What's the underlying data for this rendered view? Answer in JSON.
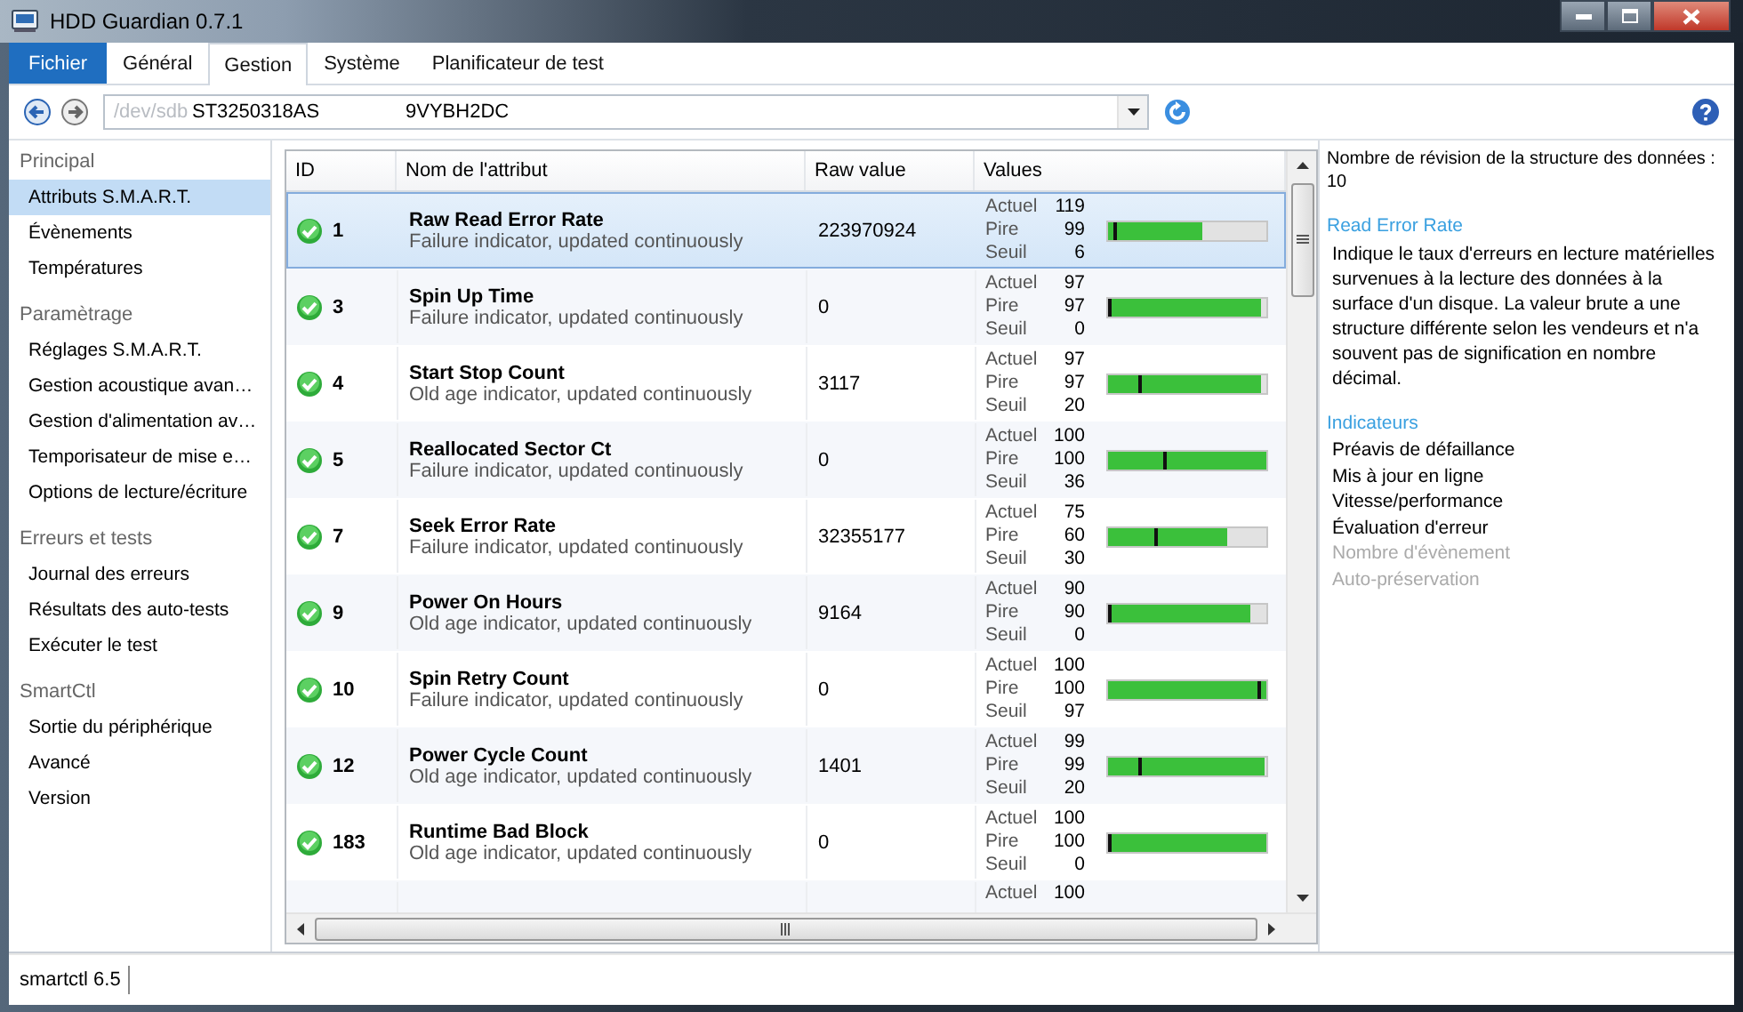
{
  "window": {
    "title": "HDD Guardian 0.7.1"
  },
  "menu": [
    {
      "label": "Fichier",
      "kind": "app",
      "selected": false
    },
    {
      "label": "Général",
      "kind": "tab",
      "selected": false
    },
    {
      "label": "Gestion",
      "kind": "tab",
      "selected": true
    },
    {
      "label": "Système",
      "kind": "tab",
      "selected": false
    },
    {
      "label": "Planificateur de test",
      "kind": "tab",
      "selected": false
    }
  ],
  "device_bar": {
    "path": "/dev/sdb",
    "model": "ST3250318AS",
    "serial": "9VYBH2DC"
  },
  "sidebar": {
    "groups": [
      {
        "title": "Principal",
        "items": [
          {
            "label": "Attributs S.M.A.R.T.",
            "selected": true
          },
          {
            "label": "Évènements",
            "selected": false
          },
          {
            "label": "Températures",
            "selected": false
          }
        ]
      },
      {
        "title": "Paramètrage",
        "items": [
          {
            "label": "Réglages S.M.A.R.T.",
            "selected": false
          },
          {
            "label": "Gestion acoustique avan…",
            "selected": false
          },
          {
            "label": "Gestion d'alimentation av…",
            "selected": false
          },
          {
            "label": "Temporisateur de mise e…",
            "selected": false
          },
          {
            "label": "Options de lecture/écriture",
            "selected": false
          }
        ]
      },
      {
        "title": "Erreurs et tests",
        "items": [
          {
            "label": "Journal des erreurs",
            "selected": false
          },
          {
            "label": "Résultats des auto-tests",
            "selected": false
          },
          {
            "label": "Exécuter le test",
            "selected": false
          }
        ]
      },
      {
        "title": "SmartCtl",
        "items": [
          {
            "label": "Sortie du périphérique",
            "selected": false
          },
          {
            "label": "Avancé",
            "selected": false
          },
          {
            "label": "Version",
            "selected": false
          }
        ]
      }
    ]
  },
  "table": {
    "columns": [
      "ID",
      "Nom de l'attribut",
      "Raw value",
      "Values"
    ],
    "rows": [
      {
        "kind": "full",
        "healthy": true,
        "selected": true,
        "id": "1",
        "name": "Raw Read Error Rate",
        "type": "Failure indicator, updated continuously",
        "raw": "223970924",
        "values": [
          {
            "label": "Actuel",
            "value": "119"
          },
          {
            "label": "Pire",
            "value": "99"
          },
          {
            "label": "Seuil",
            "value": "6"
          }
        ],
        "bar": {
          "level": 0.6
        },
        "threshold_mark": {
          "level": 0.03
        }
      },
      {
        "kind": "full",
        "healthy": true,
        "selected": false,
        "id": "3",
        "name": "Spin Up Time",
        "type": "Failure indicator, updated continuously",
        "raw": "0",
        "values": [
          {
            "label": "Actuel",
            "value": "97"
          },
          {
            "label": "Pire",
            "value": "97"
          },
          {
            "label": "Seuil",
            "value": "0"
          }
        ],
        "bar": {
          "level": 0.97
        },
        "threshold_mark": {
          "level": 0
        }
      },
      {
        "kind": "full",
        "healthy": true,
        "selected": false,
        "id": "4",
        "name": "Start Stop Count",
        "type": "Old age indicator, updated continuously",
        "raw": "3117",
        "values": [
          {
            "label": "Actuel",
            "value": "97"
          },
          {
            "label": "Pire",
            "value": "97"
          },
          {
            "label": "Seuil",
            "value": "20"
          }
        ],
        "bar": {
          "level": 0.97
        },
        "threshold_mark": {
          "level": 0.2
        }
      },
      {
        "kind": "full",
        "healthy": true,
        "selected": false,
        "id": "5",
        "name": "Reallocated Sector Ct",
        "type": "Failure indicator, updated continuously",
        "raw": "0",
        "values": [
          {
            "label": "Actuel",
            "value": "100"
          },
          {
            "label": "Pire",
            "value": "100"
          },
          {
            "label": "Seuil",
            "value": "36"
          }
        ],
        "bar": {
          "level": 1
        },
        "threshold_mark": {
          "level": 0.36
        }
      },
      {
        "kind": "full",
        "healthy": true,
        "selected": false,
        "id": "7",
        "name": "Seek Error Rate",
        "type": "Failure indicator, updated continuously",
        "raw": "32355177",
        "values": [
          {
            "label": "Actuel",
            "value": "75"
          },
          {
            "label": "Pire",
            "value": "60"
          },
          {
            "label": "Seuil",
            "value": "30"
          }
        ],
        "bar": {
          "level": 0.75
        },
        "threshold_mark": {
          "level": 0.3
        }
      },
      {
        "kind": "full",
        "healthy": true,
        "selected": false,
        "id": "9",
        "name": "Power On Hours",
        "type": "Old age indicator, updated continuously",
        "raw": "9164",
        "values": [
          {
            "label": "Actuel",
            "value": "90"
          },
          {
            "label": "Pire",
            "value": "90"
          },
          {
            "label": "Seuil",
            "value": "0"
          }
        ],
        "bar": {
          "level": 0.9
        },
        "threshold_mark": {
          "level": 0
        }
      },
      {
        "kind": "full",
        "healthy": true,
        "selected": false,
        "id": "10",
        "name": "Spin Retry Count",
        "type": "Failure indicator, updated continuously",
        "raw": "0",
        "values": [
          {
            "label": "Actuel",
            "value": "100"
          },
          {
            "label": "Pire",
            "value": "100"
          },
          {
            "label": "Seuil",
            "value": "97"
          }
        ],
        "bar": {
          "level": 1
        },
        "threshold_mark": {
          "level": 0.97
        }
      },
      {
        "kind": "full",
        "healthy": true,
        "selected": false,
        "id": "12",
        "name": "Power Cycle Count",
        "type": "Old age indicator, updated continuously",
        "raw": "1401",
        "values": [
          {
            "label": "Actuel",
            "value": "99"
          },
          {
            "label": "Pire",
            "value": "99"
          },
          {
            "label": "Seuil",
            "value": "20"
          }
        ],
        "bar": {
          "level": 0.99
        },
        "threshold_mark": {
          "level": 0.2
        }
      },
      {
        "kind": "full",
        "healthy": true,
        "selected": false,
        "id": "183",
        "name": "Runtime Bad Block",
        "type": "Old age indicator, updated continuously",
        "raw": "0",
        "values": [
          {
            "label": "Actuel",
            "value": "100"
          },
          {
            "label": "Pire",
            "value": "100"
          },
          {
            "label": "Seuil",
            "value": "0"
          }
        ],
        "bar": {
          "level": 1
        },
        "threshold_mark": {
          "level": 0
        }
      },
      {
        "kind": "partial",
        "selected": false,
        "values": [
          {
            "label": "Actuel",
            "value": "100"
          }
        ]
      }
    ]
  },
  "detail": {
    "revision_label": "Nombre de révision de la structure des données :",
    "revision": "10",
    "attribute_title": "Read Error Rate",
    "description": "Indique le taux d'erreurs en lecture matérielles survenues à la lecture des données à la surface d'un disque. La valeur brute a une structure différente selon les vendeurs et n'a souvent pas de signification en nombre décimal.",
    "indicators_title": "Indicateurs",
    "indicators": [
      {
        "label": "Préavis de défaillance",
        "active": true
      },
      {
        "label": "Mis à jour en ligne",
        "active": true
      },
      {
        "label": "Vitesse/performance",
        "active": true
      },
      {
        "label": "Évaluation d'erreur",
        "active": true
      },
      {
        "label": "Nombre d'évènement",
        "active": false
      },
      {
        "label": "Auto-préservation",
        "active": false
      }
    ]
  },
  "status_bar": {
    "text": "smartctl 6.5"
  }
}
